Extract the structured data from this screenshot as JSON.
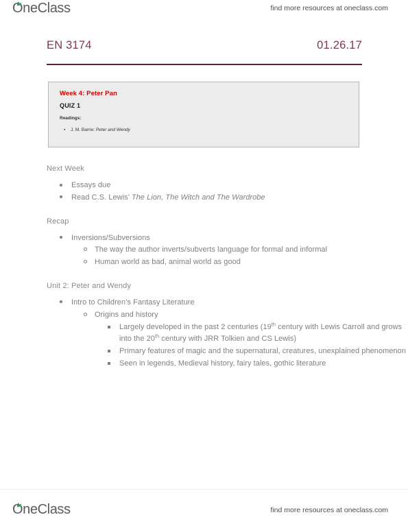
{
  "branding": {
    "logo_text": "OneClass",
    "logo_icon": "leaf-sprout-icon",
    "watermark": "find more resources at oneclass.com"
  },
  "header": {
    "course_code": "EN 3174",
    "date": "01.26.17",
    "rule_color": "#5e2130",
    "text_color": "#7b3a4d"
  },
  "callout": {
    "title": "Week 4: Peter Pan",
    "title_color": "#cc0000",
    "subtitle": "QUIZ 1",
    "readings_label": "Readings:",
    "readings": [
      {
        "bullet": "▪",
        "author": "J. M. Barrie: ",
        "work": "Peter and Wendy"
      }
    ],
    "background": "#ececec",
    "border_color": "#b5b5b5"
  },
  "sections": [
    {
      "heading": "Next Week",
      "items": [
        {
          "level": 1,
          "text": "Essays due"
        },
        {
          "level": 1,
          "prefix": "Read C.S. Lewis’ ",
          "italic": "The Lion, The Witch and The Wardrobe"
        }
      ]
    },
    {
      "heading": "Recap",
      "items": [
        {
          "level": 1,
          "text": "Inversions/Subversions"
        },
        {
          "level": 2,
          "text": "The way the author inverts/subverts language for formal and informal"
        },
        {
          "level": 2,
          "text": "Human world as bad, animal world as good"
        }
      ]
    },
    {
      "heading": "Unit 2: Peter and Wendy",
      "items": [
        {
          "level": 1,
          "text": "Intro to Children’s Fantasy Literature"
        },
        {
          "level": 2,
          "text": "Origins and history"
        },
        {
          "level": 3,
          "text": "Largely developed in the past 2 centuries (19th century with Lewis Carroll and grows into the 20th century with JRR Tolkien and CS Lewis)"
        },
        {
          "level": 3,
          "text": "Primary features of magic and the supernatural, creatures, unexplained phenomenon"
        },
        {
          "level": 3,
          "text": "Seen in legends, Medieval history, fairy tales, gothic literature"
        }
      ]
    }
  ],
  "body_text_color": "#7f7f7f"
}
